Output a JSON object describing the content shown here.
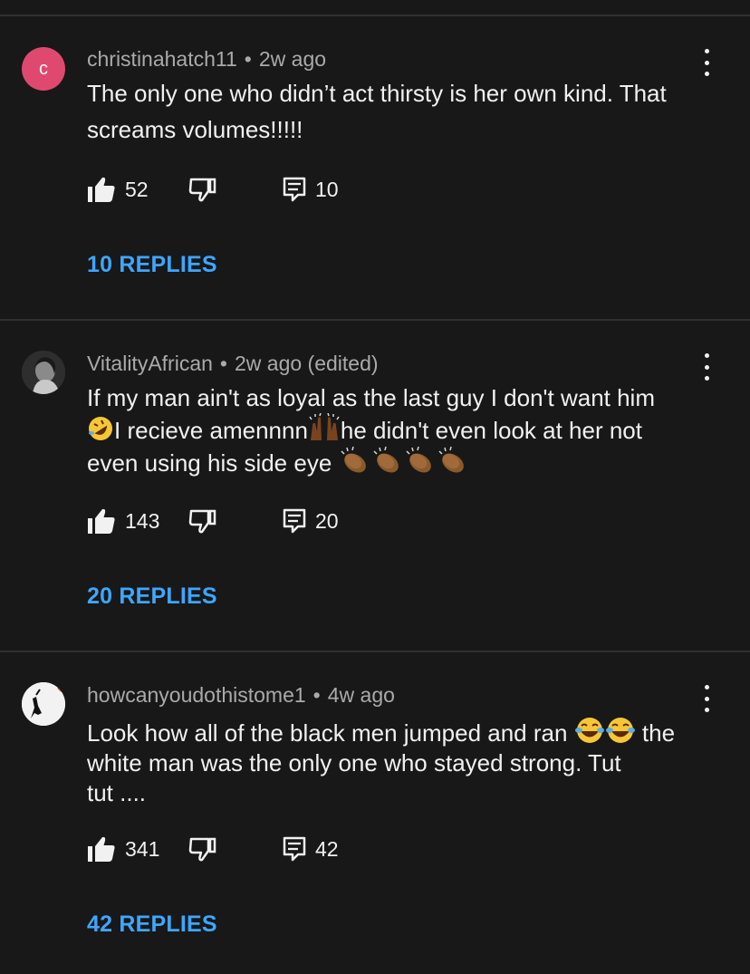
{
  "comments": [
    {
      "author": "christinahatch11",
      "time": "2w ago",
      "avatar_letter": "c",
      "avatar_color": "#e0496f",
      "text_lines": [
        "The only one who didn’t act thirsty is her own kind. That",
        "screams volumes!!!!!"
      ],
      "likes": "52",
      "reply_count": "10",
      "replies_label": "10 REPLIES"
    },
    {
      "author": "VitalityAfrican",
      "time": "2w ago (edited)",
      "text_line1": "If my man ain't as loyal as the last guy I don't want him",
      "text_line2a": "I recieve amennnn",
      "text_line2b": "he didn't even look at her not",
      "text_line3": "even using his side eye",
      "likes": "143",
      "reply_count": "20",
      "replies_label": "20 REPLIES"
    },
    {
      "author": "howcanyoudothistome1",
      "time": "4w ago",
      "text_line1a": "Look how all of the black men jumped and ran",
      "text_line1b": "the",
      "text_line2": "white man was the only one who stayed strong. Tut",
      "text_line3": "tut ....",
      "likes": "341",
      "reply_count": "42",
      "replies_label": "42 REPLIES"
    }
  ],
  "icons": {
    "like": "thumb-up-icon",
    "dislike": "thumb-down-icon",
    "reply": "reply-icon",
    "more": "more-vert-icon"
  },
  "colors": {
    "background": "#181818",
    "link": "#3ea6ff",
    "meta": "#aaaaaa",
    "text": "#f1f1f1"
  }
}
